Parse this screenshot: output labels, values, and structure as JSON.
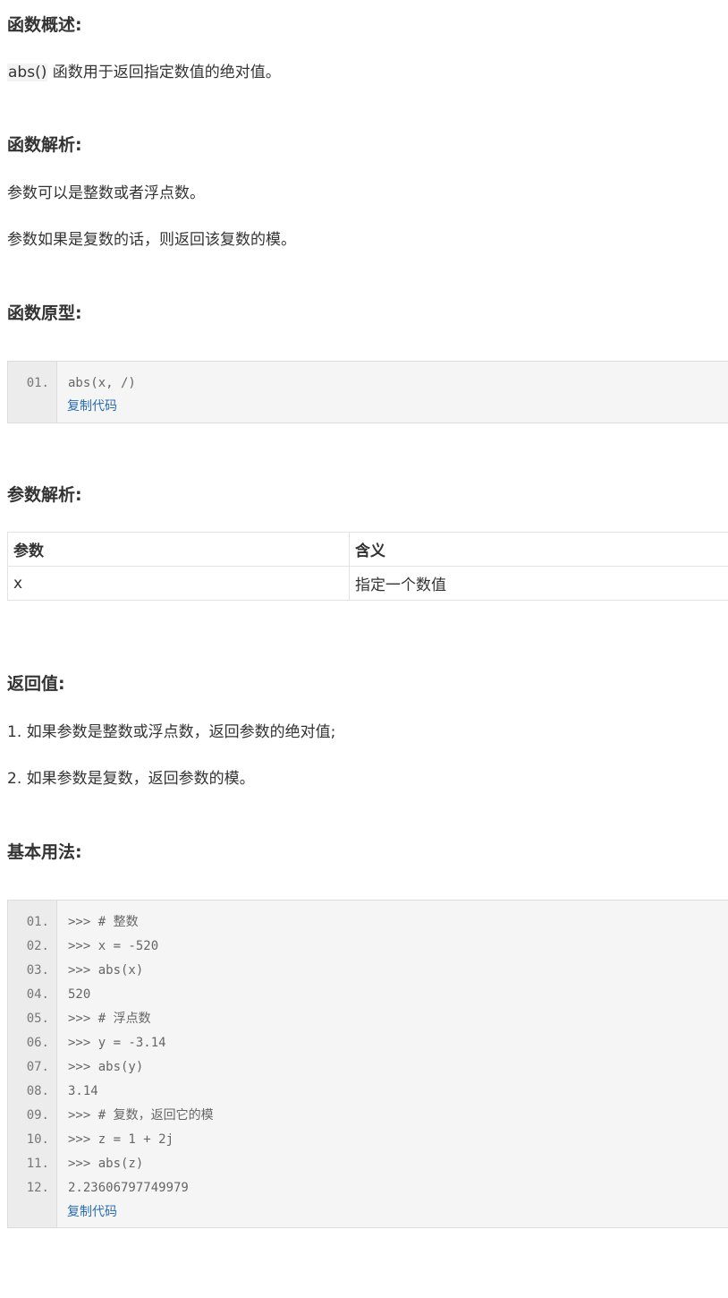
{
  "sections": {
    "overview": {
      "heading": "函数概述:",
      "code_term": "abs()",
      "text": " 函数用于返回指定数值的绝对值。"
    },
    "analysis": {
      "heading": "函数解析:",
      "para1": "参数可以是整数或者浮点数。",
      "para2": "参数如果是复数的话，则返回该复数的模。"
    },
    "prototype": {
      "heading": "函数原型:",
      "lines": [
        {
          "no": "01.",
          "code": "abs(x, /)"
        }
      ],
      "copy_label": "复制代码"
    },
    "params": {
      "heading": "参数解析:",
      "headers": [
        "参数",
        "含义"
      ],
      "rows": [
        [
          "x",
          "指定一个数值"
        ]
      ]
    },
    "returns": {
      "heading": "返回值:",
      "item1": "1. 如果参数是整数或浮点数，返回参数的绝对值;",
      "item2": "2. 如果参数是复数，返回参数的模。"
    },
    "usage": {
      "heading": "基本用法:",
      "lines": [
        {
          "no": "01.",
          "code": ">>> # 整数"
        },
        {
          "no": "02.",
          "code": ">>> x = -520"
        },
        {
          "no": "03.",
          "code": ">>> abs(x)"
        },
        {
          "no": "04.",
          "code": "520"
        },
        {
          "no": "05.",
          "code": ">>> # 浮点数"
        },
        {
          "no": "06.",
          "code": ">>> y = -3.14"
        },
        {
          "no": "07.",
          "code": ">>> abs(y)"
        },
        {
          "no": "08.",
          "code": "3.14"
        },
        {
          "no": "09.",
          "code": ">>> # 复数，返回它的模"
        },
        {
          "no": "10.",
          "code": ">>> z = 1 + 2j"
        },
        {
          "no": "11.",
          "code": ">>> abs(z)"
        },
        {
          "no": "12.",
          "code": "2.23606797749979"
        }
      ],
      "copy_label": "复制代码"
    }
  }
}
